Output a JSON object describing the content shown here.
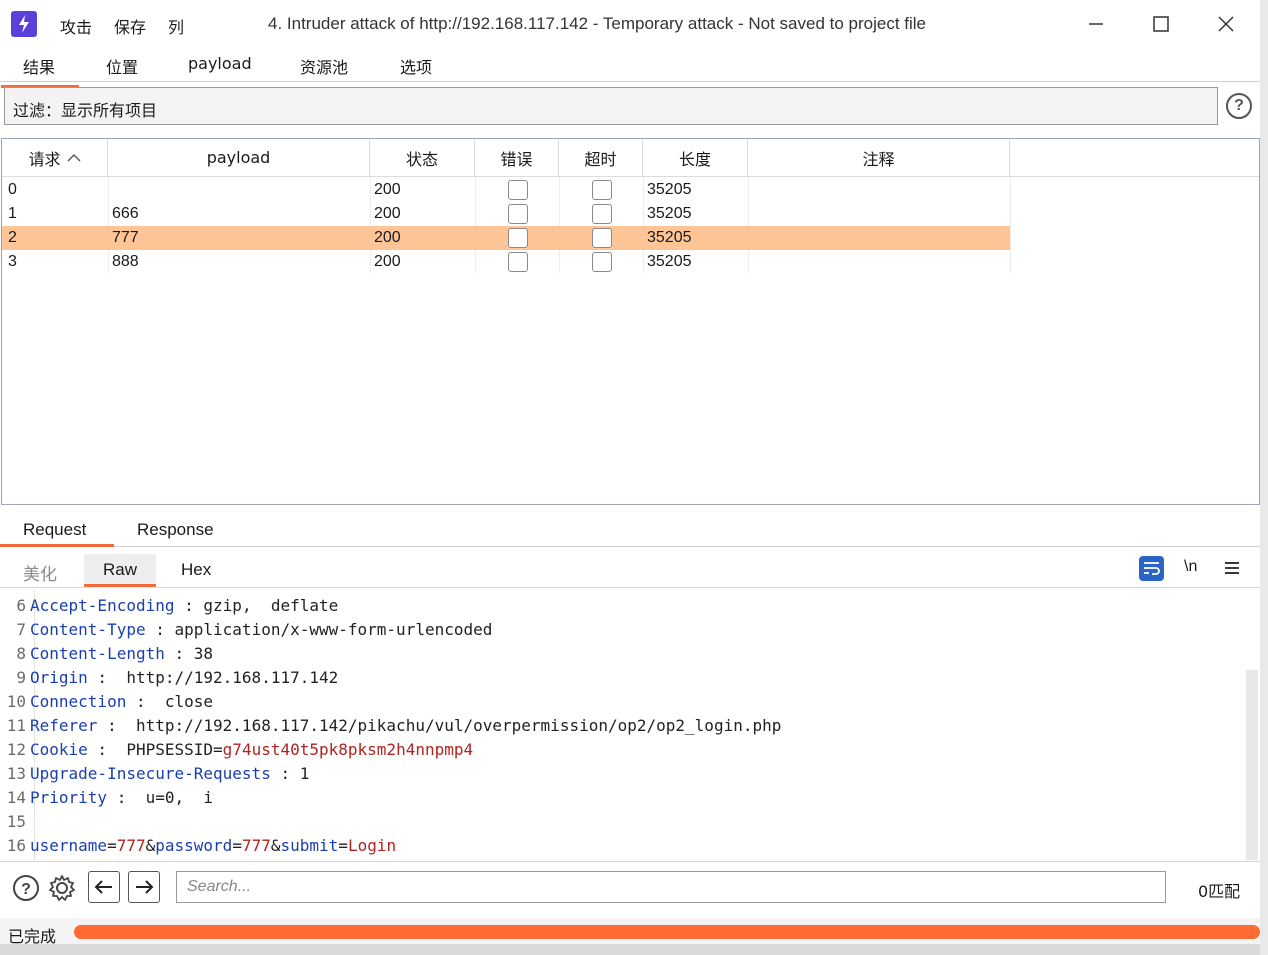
{
  "window": {
    "title": "4. Intruder attack of http://192.168.117.142 - Temporary attack - Not saved to project file",
    "menu": [
      "攻击",
      "保存",
      "列"
    ]
  },
  "main_tabs": [
    "结果",
    "位置",
    "payload",
    "资源池",
    "选项"
  ],
  "active_main_tab": "结果",
  "filter": {
    "label": "过滤：显示所有项目"
  },
  "table": {
    "columns": [
      "请求",
      "payload",
      "状态",
      "错误",
      "超时",
      "长度",
      "注释"
    ],
    "sort_column": "请求",
    "sort_direction": "ascending",
    "rows": [
      {
        "request": "0",
        "payload": "",
        "status": "200",
        "error": false,
        "timeout": false,
        "length": "35205",
        "comment": ""
      },
      {
        "request": "1",
        "payload": "666",
        "status": "200",
        "error": false,
        "timeout": false,
        "length": "35205",
        "comment": ""
      },
      {
        "request": "2",
        "payload": "777",
        "status": "200",
        "error": false,
        "timeout": false,
        "length": "35205",
        "comment": "",
        "selected": true
      },
      {
        "request": "3",
        "payload": "888",
        "status": "200",
        "error": false,
        "timeout": false,
        "length": "35205",
        "comment": ""
      }
    ],
    "selected_color": "#ffc597"
  },
  "message_tabs": [
    "Request",
    "Response"
  ],
  "active_message_tab": "Request",
  "view_tabs": [
    "美化",
    "Raw",
    "Hex"
  ],
  "active_view_tab": "Raw",
  "view_tools": {
    "wrap": "wrap-icon",
    "newline": "\\n",
    "menu": "menu-icon"
  },
  "editor": {
    "lines": [
      {
        "n": "6",
        "key": "Accept-Encoding",
        "sep": " : ",
        "val": "gzip,  deflate"
      },
      {
        "n": "7",
        "key": "Content-Type",
        "sep": " : ",
        "val": "application/x-www-form-urlencoded"
      },
      {
        "n": "8",
        "key": "Content-Length",
        "sep": " : ",
        "val": "38"
      },
      {
        "n": "9",
        "key": "Origin",
        "sep": " :  ",
        "val": "http://192.168.117.142"
      },
      {
        "n": "10",
        "key": "Connection",
        "sep": " :  ",
        "val": "close"
      },
      {
        "n": "11",
        "key": "Referer",
        "sep": " :  ",
        "val": "http://192.168.117.142/pikachu/vul/overpermission/op2/op2_login.php"
      },
      {
        "n": "12",
        "key": "Cookie",
        "sep": " :  ",
        "val": "PHPSESSID",
        "eq": "=",
        "red": "g74ust40t5pk8pksm2h4nnpmp4"
      },
      {
        "n": "13",
        "key": "Upgrade-Insecure-Requests",
        "sep": " : ",
        "val": "1"
      },
      {
        "n": "14",
        "key": "Priority",
        "sep": " :  ",
        "val": "u=0,  i"
      },
      {
        "n": "15",
        "key": "",
        "sep": "",
        "val": ""
      }
    ],
    "body_line": {
      "n": "16",
      "p1k": "username",
      "p1v": "777",
      "amp1": "&",
      "p2k": "password",
      "p2v": "777",
      "amp2": "&",
      "p3k": "submit",
      "p3v": "Login"
    }
  },
  "search": {
    "placeholder": "Search...",
    "matches": "0匹配"
  },
  "status": {
    "text": "已完成",
    "progress": 1.0,
    "progress_color": "#ff6b35"
  },
  "colors": {
    "accent": "#f26b3a",
    "app_icon": "#5b3fd9",
    "key_blue": "#1a3fae",
    "value_red": "#b0241e"
  }
}
